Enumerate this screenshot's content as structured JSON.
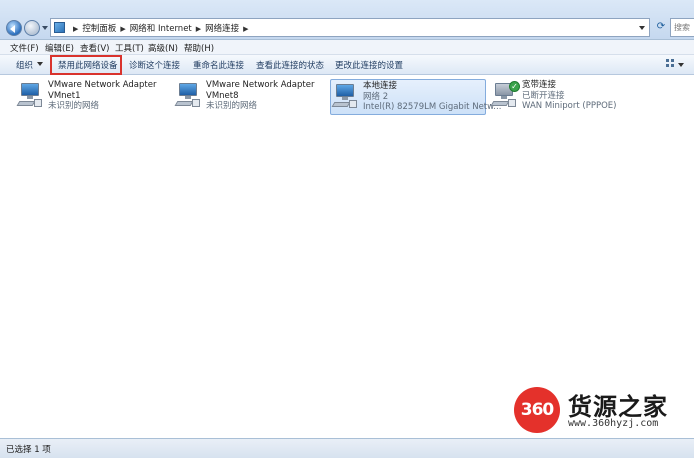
{
  "address": {
    "crumbs": [
      "控制面板",
      "网络和 Internet",
      "网络连接"
    ],
    "search_placeholder": "搜索"
  },
  "menu": [
    {
      "label": "文件(F)"
    },
    {
      "label": "编辑(E)"
    },
    {
      "label": "查看(V)"
    },
    {
      "label": "工具(T)"
    },
    {
      "label": "高级(N)"
    },
    {
      "label": "帮助(H)"
    }
  ],
  "commands": {
    "organize": "组织",
    "disable": "禁用此网络设备",
    "diagnose": "诊断这个连接",
    "rename": "重命名此连接",
    "status": "查看此连接的状态",
    "change": "更改此连接的设置"
  },
  "connections": [
    {
      "name": "VMware Network Adapter",
      "line2": "VMnet1",
      "line3": "未识别的网络"
    },
    {
      "name": "VMware Network Adapter",
      "line2": "VMnet8",
      "line3": "未识别的网络"
    },
    {
      "name": "本地连接",
      "line2": "网络 2",
      "line3": "Intel(R) 82579LM Gigabit Netw..."
    },
    {
      "name": "宽带连接",
      "line2": "已断开连接",
      "line3": "WAN Miniport (PPPOE)"
    }
  ],
  "statusbar": {
    "text": "已选择 1 项"
  },
  "watermark": {
    "badge": "360",
    "brand": "货源之家",
    "url": "www.360hyzj.com"
  },
  "colors": {
    "highlight_border": "#d9332d",
    "selected_bg": "#cde1f8"
  }
}
